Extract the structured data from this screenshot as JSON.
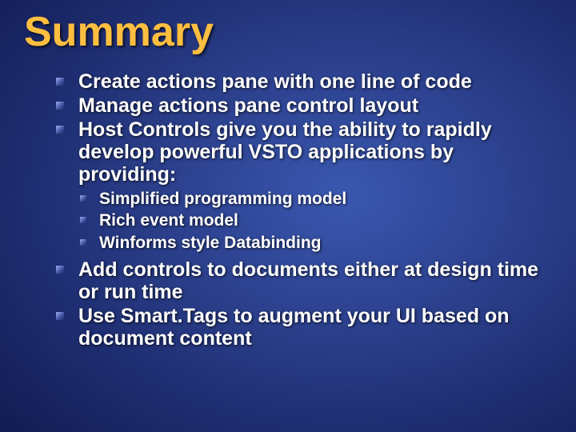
{
  "title": "Summary",
  "bullets": {
    "0": "Create actions pane with one line of code",
    "1": "Manage actions pane control layout",
    "2": "Host Controls give you the ability to rapidly develop powerful VSTO applications by providing:",
    "sub": {
      "0": "Simplified programming model",
      "1": "Rich event model",
      "2": "Winforms style Databinding"
    },
    "3": "Add controls to documents either at design time or run time",
    "4": "Use Smart.Tags to augment your UI based on document content"
  }
}
